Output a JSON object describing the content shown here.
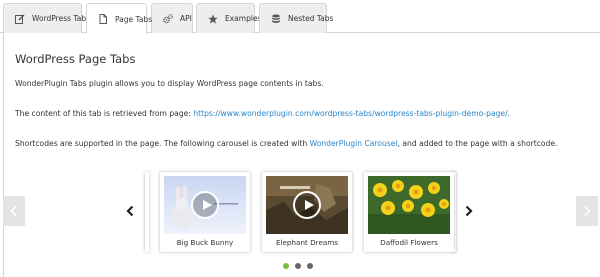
{
  "tabs": [
    {
      "label": "WordPress Tabs",
      "icon": "edit-icon"
    },
    {
      "label": "Page Tabs",
      "icon": "file-icon"
    },
    {
      "label": "API",
      "icon": "gears-icon"
    },
    {
      "label": "Examples",
      "icon": "star-icon"
    },
    {
      "label": "Nested Tabs",
      "icon": "database-icon"
    }
  ],
  "active_tab": "Page Tabs",
  "content": {
    "title": "WordPress Page Tabs",
    "intro": "WonderPlugin Tabs plugin allows you to display WordPress page contents in tabs.",
    "source_prefix": "The content of this tab is retrieved from page: ",
    "source_link": "https://www.wonderplugin.com/wordpress-tabs/wordpress-tabs-plugin-demo-page/",
    "source_suffix": ".",
    "shortcode_prefix": "Shortcodes are supported in the page. The following carousel is created with ",
    "shortcode_link": "WonderPlugin Carousel",
    "shortcode_suffix": ", and added to the page with a shortcode."
  },
  "carousel": {
    "items": [
      {
        "caption": "Big Buck Bunny",
        "video": true
      },
      {
        "caption": "Elephant Dreams",
        "video": true
      },
      {
        "caption": "Daffodil Flowers",
        "video": false
      }
    ],
    "pages": 3,
    "current_page": 1
  },
  "colors": {
    "link": "#2a84c9",
    "dot_active": "#7bbf3f",
    "dot_inactive": "#666666",
    "tab_bg": "#eeeeee",
    "border": "#d6d6d6"
  }
}
